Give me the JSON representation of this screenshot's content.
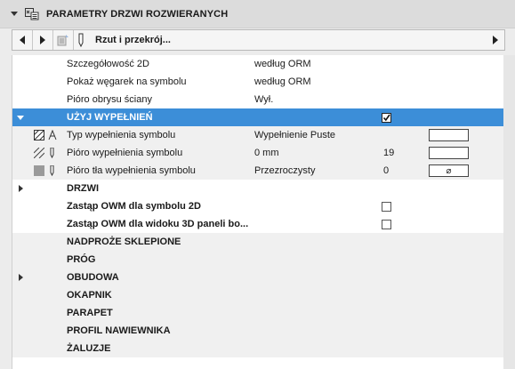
{
  "header": {
    "title": "PARAMETRY DRZWI ROZWIERANYCH"
  },
  "toolbar": {
    "view_label": "Rzut i przekrój..."
  },
  "rows": [
    {
      "label": "Szczegółowość 2D",
      "value": "według ORM"
    },
    {
      "label": "Pokaż węgarek na symbolu",
      "value": "według ORM"
    },
    {
      "label": "Pióro obrysu ściany",
      "value": "Wył."
    },
    {
      "label": "UŻYJ WYPEŁNIEŃ",
      "checked": true
    },
    {
      "label": "Typ wypełnienia symbolu",
      "value": "Wypełnienie Puste"
    },
    {
      "label": "Pióro wypełnienia symbolu",
      "value": "0 mm",
      "number": "19"
    },
    {
      "label": "Pióro tła wypełnienia symbolu",
      "value": "Przezroczysty",
      "number": "0",
      "swatch": "⌀"
    },
    {
      "label": "DRZWI"
    },
    {
      "label": "Zastąp OWM dla symbolu 2D",
      "checked": false
    },
    {
      "label": "Zastąp OWM dla widoku 3D paneli bo...",
      "checked": false
    },
    {
      "label": "NADPROŻE SKLEPIONE"
    },
    {
      "label": "PRÓG"
    },
    {
      "label": "OBUDOWA"
    },
    {
      "label": "OKAPNIK"
    },
    {
      "label": "PARAPET"
    },
    {
      "label": "PROFIL NAWIEWNIKA"
    },
    {
      "label": "ŻALUZJE"
    }
  ],
  "colors": {
    "selection": "#3c8ed8"
  }
}
